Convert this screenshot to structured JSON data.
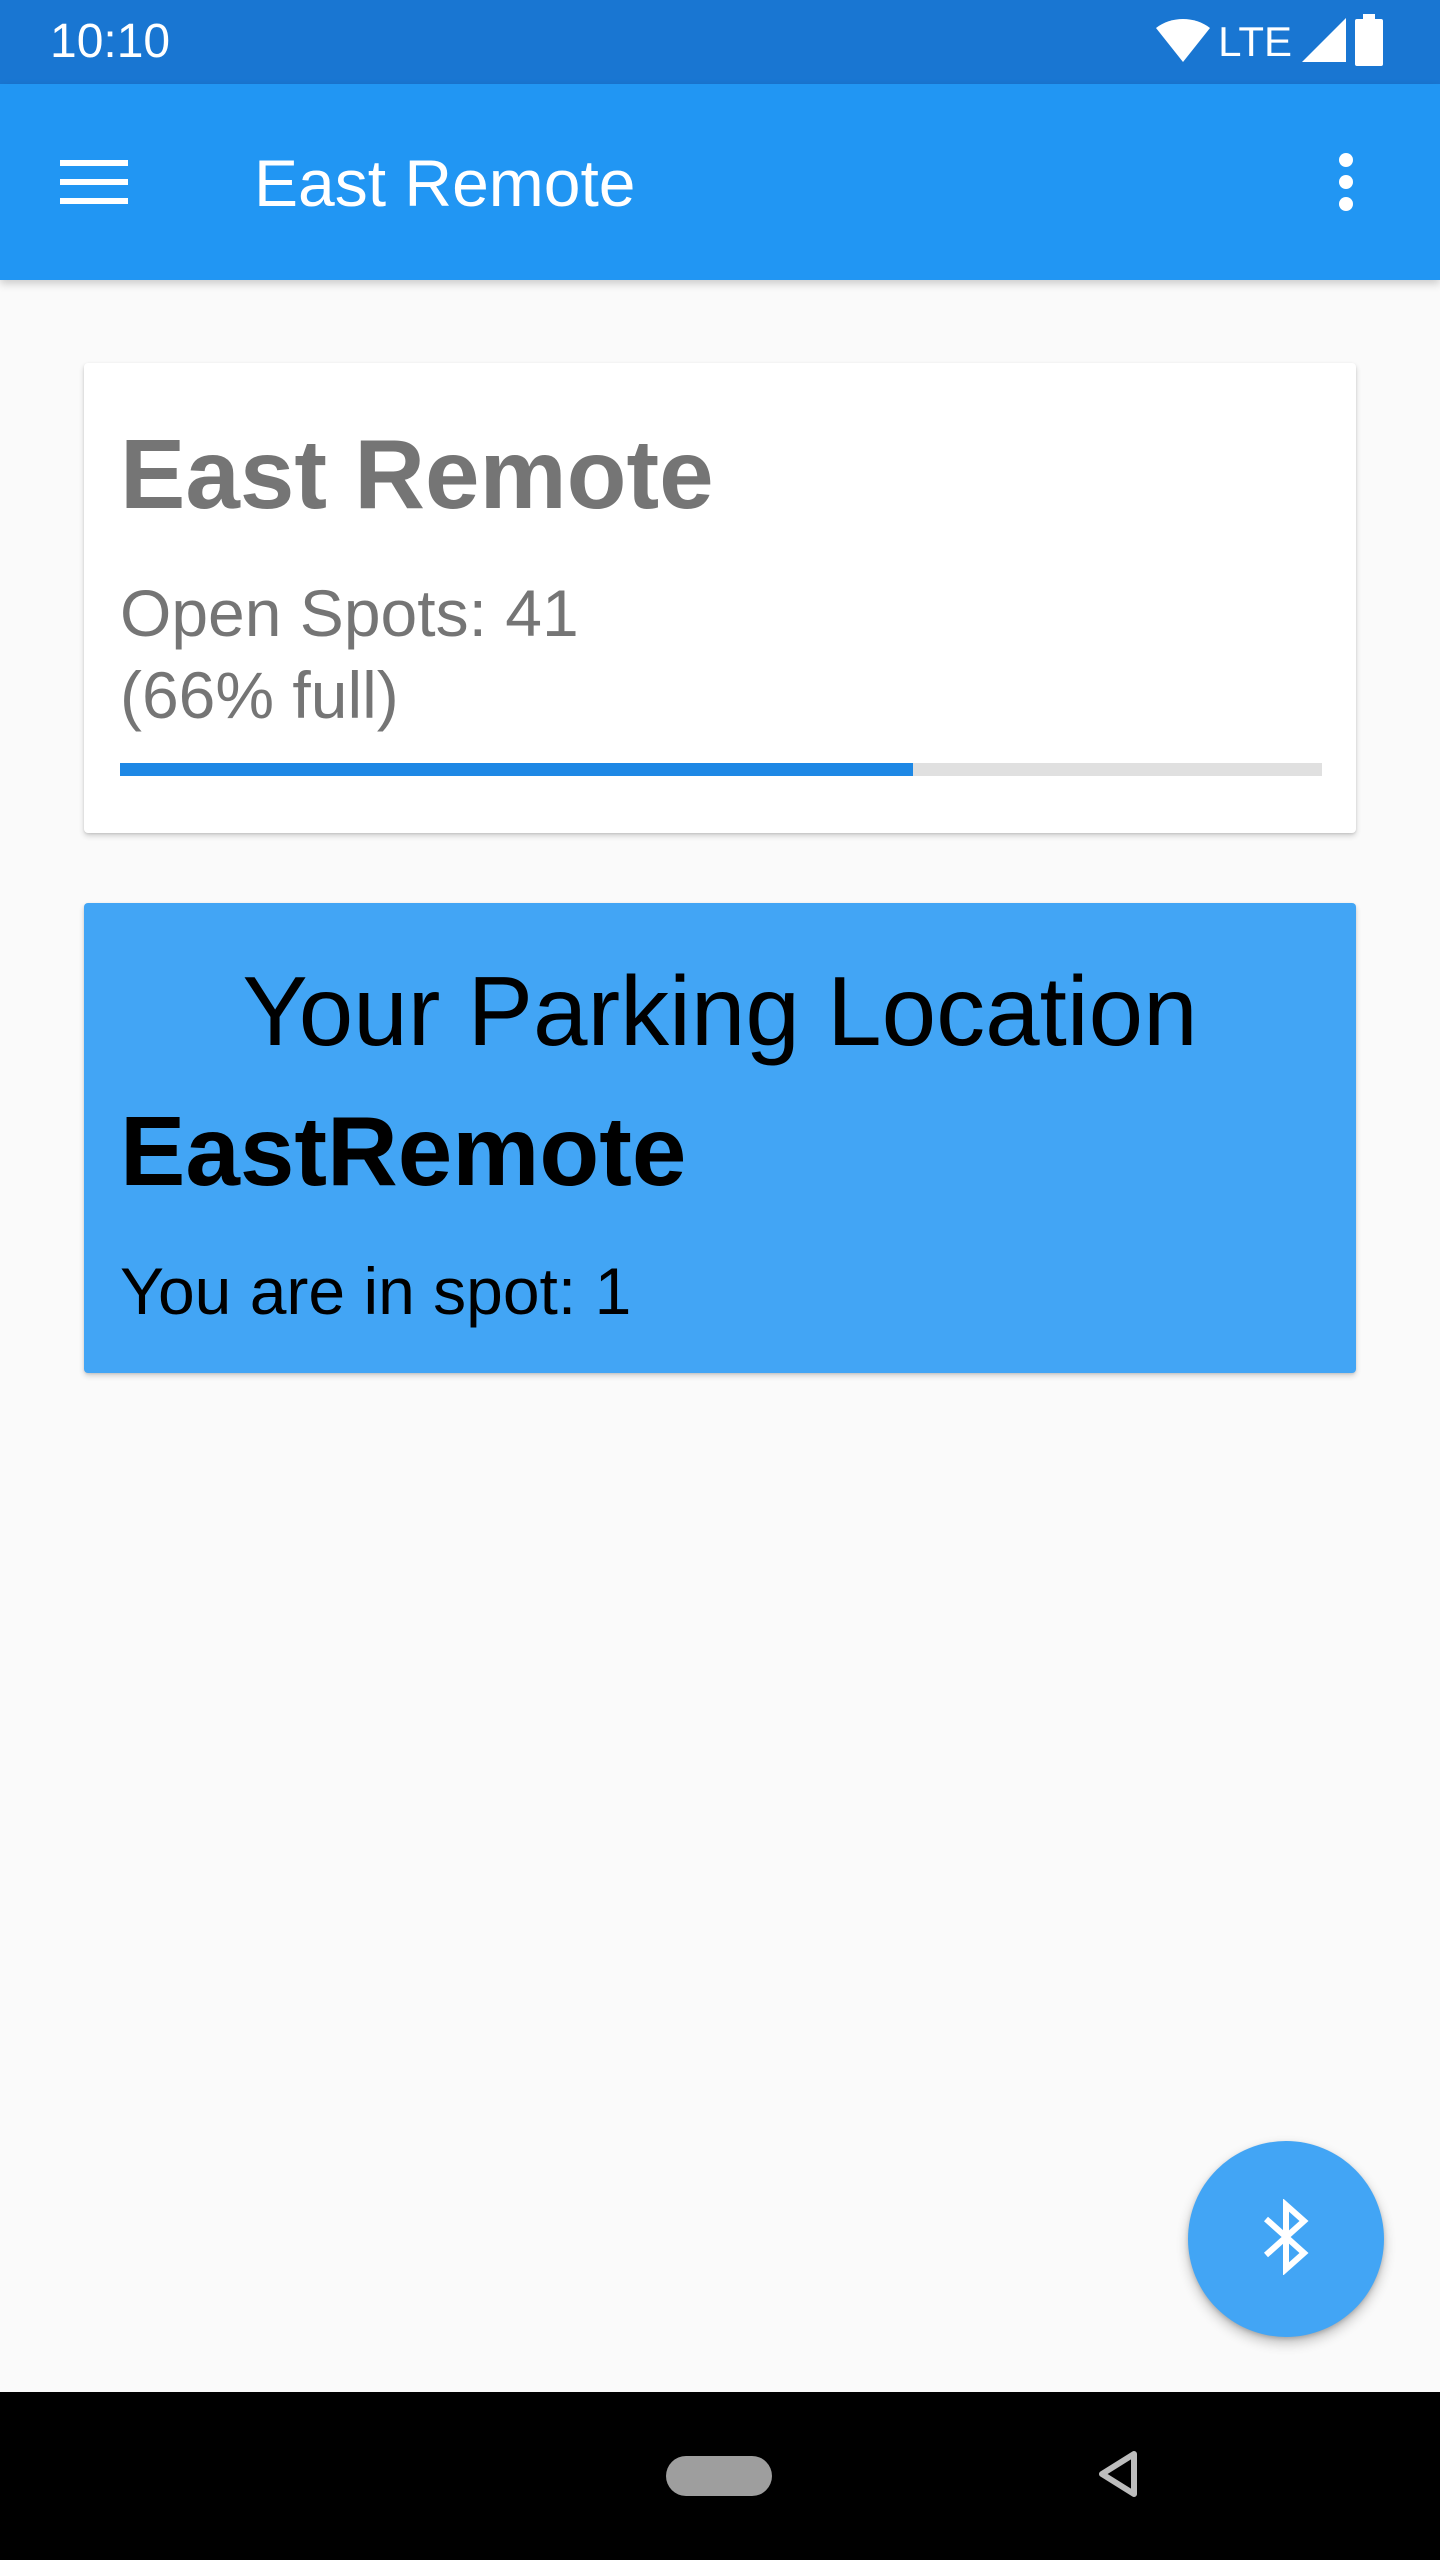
{
  "status_bar": {
    "time": "10:10",
    "network": "LTE",
    "icons": [
      "wifi-icon",
      "signal-icon",
      "battery-icon"
    ]
  },
  "app_bar": {
    "title": "East Remote",
    "menu_icon": "hamburger-menu-icon",
    "overflow_icon": "more-vert-icon"
  },
  "lot_card": {
    "name": "East Remote",
    "open_spots_text": "Open Spots: 41",
    "percent_full_text": "(66% full)",
    "percent_full": 0.66
  },
  "location_card": {
    "heading": "Your Parking Location",
    "location_name": "EastRemote",
    "spot_text": "You are in spot: 1"
  },
  "fab": {
    "icon": "bluetooth-icon"
  },
  "nav_bar": {
    "icons": [
      "home-pill-icon",
      "back-icon"
    ]
  },
  "colors": {
    "status_bar": "#1976d2",
    "app_bar": "#2196f3",
    "progress": "#1e88e5",
    "progress_track": "#e0e0e0",
    "location_card": "#42a5f5",
    "fab": "#42a5f5",
    "muted_text": "#757575"
  }
}
